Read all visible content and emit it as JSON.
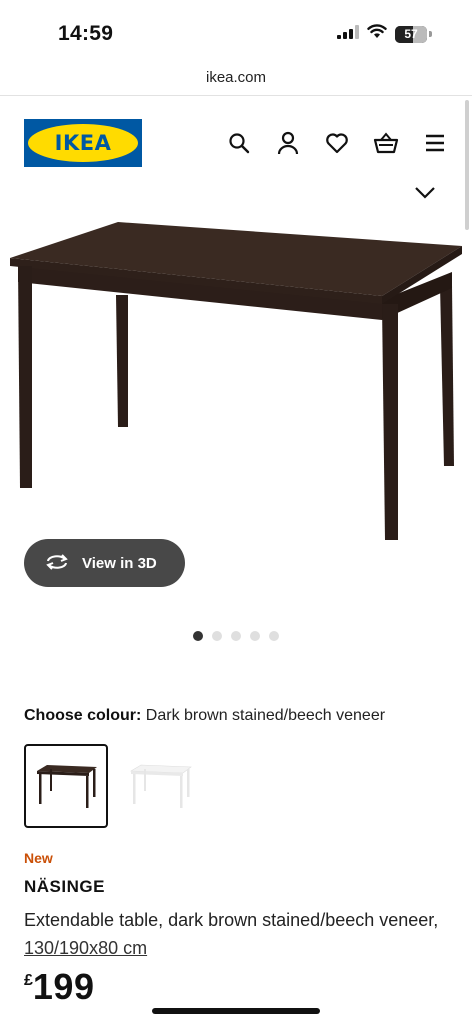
{
  "status_bar": {
    "time": "14:59",
    "battery_level": "57",
    "icons": [
      "signal-icon",
      "wifi-icon",
      "battery-icon"
    ]
  },
  "browser": {
    "url": "ikea.com"
  },
  "header": {
    "logo_text": "IKEA",
    "icons": [
      "search-icon",
      "profile-icon",
      "heart-icon",
      "basket-icon",
      "menu-icon"
    ],
    "brand_colors": {
      "blue": "#0058a3",
      "yellow": "#ffdb00"
    }
  },
  "gallery": {
    "view3d_label": "View in 3D",
    "image_count": 5,
    "active_index": 0
  },
  "colour": {
    "label": "Choose colour:",
    "value": "Dark brown stained/beech veneer",
    "options": [
      {
        "name": "dark brown",
        "color": "#3a2a22",
        "selected": true
      },
      {
        "name": "white",
        "color": "#f7f7f7",
        "selected": false
      }
    ]
  },
  "product": {
    "badge": "New",
    "badge_color": "#ca5008",
    "name": "NÄSINGE",
    "description": "Extendable table, dark brown stained/beech veneer,",
    "dimensions": "130/190x80 cm",
    "price_currency": "£",
    "price_value": "199"
  }
}
